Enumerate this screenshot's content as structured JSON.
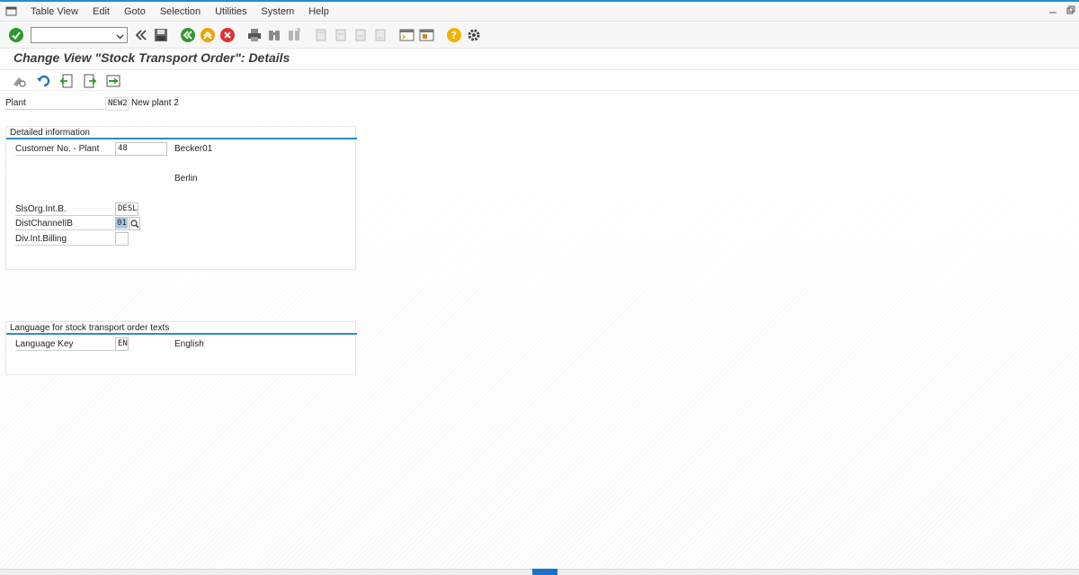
{
  "menubar": {
    "items": [
      "Table View",
      "Edit",
      "Goto",
      "Selection",
      "Utilities",
      "System",
      "Help"
    ]
  },
  "toolbar": {
    "command_field_value": ""
  },
  "page": {
    "title": "Change View \"Stock Transport Order\": Details"
  },
  "header": {
    "plant_label": "Plant",
    "plant_value": "NEW2",
    "plant_name": "New plant 2"
  },
  "detailed_info": {
    "title": "Detailed information",
    "customer_label": "Customer No. - Plant",
    "customer_value": "48",
    "customer_name": "Becker01",
    "customer_city": "Berlin",
    "slsorg_label": "SlsOrg.Int.B.",
    "slsorg_value": "DESL",
    "distchannel_label": "DistChannelIB",
    "distchannel_value": "01",
    "division_label": "Div.Int.Billing",
    "division_value": ""
  },
  "language": {
    "title": "Language for stock transport order texts",
    "key_label": "Language Key",
    "key_value": "EN",
    "key_text": "English"
  },
  "colors": {
    "accent": "#2f8cbf",
    "ok_green": "#2e9a2e",
    "nav_orange": "#f0a500",
    "cancel_red": "#e03030",
    "help_yellow": "#f3b400"
  },
  "icons": [
    "enter-icon",
    "back-icon",
    "save-icon",
    "exit-icon",
    "cancel-icon",
    "print-icon",
    "find-icon",
    "help-icon",
    "settings-icon"
  ]
}
